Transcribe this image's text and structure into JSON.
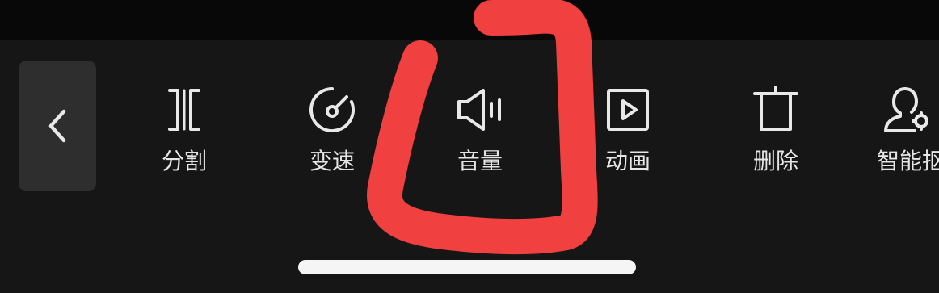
{
  "toolbar": {
    "back_icon": "chevron-left-icon",
    "tools": [
      {
        "id": "split",
        "label": "分割",
        "icon": "split-icon"
      },
      {
        "id": "speed",
        "label": "变速",
        "icon": "speed-icon"
      },
      {
        "id": "volume",
        "label": "音量",
        "icon": "volume-icon"
      },
      {
        "id": "animation",
        "label": "动画",
        "icon": "animation-icon"
      },
      {
        "id": "delete",
        "label": "删除",
        "icon": "delete-icon"
      },
      {
        "id": "smart-cutout",
        "label": "智能抠",
        "icon": "smart-cutout-icon"
      }
    ]
  },
  "annotation": {
    "color": "#f04040",
    "target": "volume"
  },
  "colors": {
    "background": "#161616",
    "top_strip": "#080808",
    "back_button": "#2e2e2e",
    "icon": "#e8e8e8",
    "label": "#e6e6e6",
    "home_indicator": "#f5f5f5"
  }
}
